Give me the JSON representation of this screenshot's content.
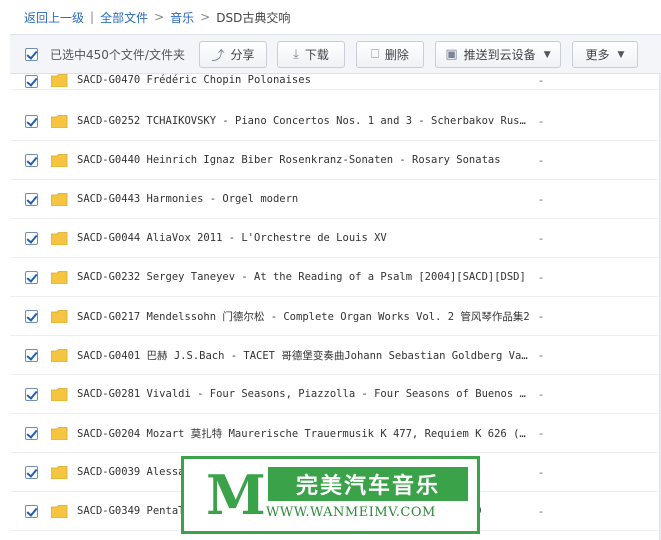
{
  "breadcrumb": {
    "back": "返回上一级",
    "separator": "|",
    "all_files": "全部文件",
    "arrow": ">",
    "music": "音乐",
    "current": "DSD古典交响"
  },
  "toolbar": {
    "selection_text": "已选中450个文件/文件夹",
    "share": "分享",
    "download": "下载",
    "delete": "删除",
    "push_cloud": "推送到云设备",
    "more": "更多"
  },
  "rows": [
    {
      "name": "SACD-G0470 Frédéric Chopin Polonaises",
      "size": "-"
    },
    {
      "name": "SACD-G0252 TCHAIKOVSKY - Piano Concertos Nos. 1 and 3 - Scherbakov Russia…",
      "size": "-"
    },
    {
      "name": "SACD-G0440 Heinrich Ignaz Biber Rosenkranz-Sonaten - Rosary Sonatas",
      "size": "-"
    },
    {
      "name": "SACD-G0443 Harmonies - Orgel modern",
      "size": "-"
    },
    {
      "name": "SACD-G0044 AliaVox 2011 - L'Orchestre de Louis XV",
      "size": "-"
    },
    {
      "name": "SACD-G0232 Sergey Taneyev - At the Reading of a Psalm [2004][SACD][DSD]",
      "size": "-"
    },
    {
      "name": "SACD-G0217 Mendelssohn 门德尔松 - Complete Organ Works Vol. 2 管风琴作品集2",
      "size": "-"
    },
    {
      "name": "SACD-G0401 巴赫 J.S.Bach - TACET 哥德堡变奏曲Johann Sebastian Goldberg Va…",
      "size": "-"
    },
    {
      "name": "SACD-G0281 Vivaldi - Four Seasons, Piazzolla - Four Seasons of Buenos Air…",
      "size": "-"
    },
    {
      "name": "SACD-G0204 Mozart 莫扎特 Maurerische Trauermusik K 477, Requiem K 626 (Jo…",
      "size": "-"
    },
    {
      "name": "SACD-G0039 Alessa",
      "size": "-"
    },
    {
      "name": "SACD-G0349 PentaT                                            ACD",
      "size": "-"
    }
  ],
  "watermark": {
    "logo": "M",
    "title": "完美汽车音乐",
    "url": "WWW.WANMEIMV.COM"
  },
  "colors": {
    "link": "#2a6bbd",
    "checkbox": "#1d5fb5",
    "folder": "#f5c542",
    "watermark_green": "#3aa34a"
  }
}
